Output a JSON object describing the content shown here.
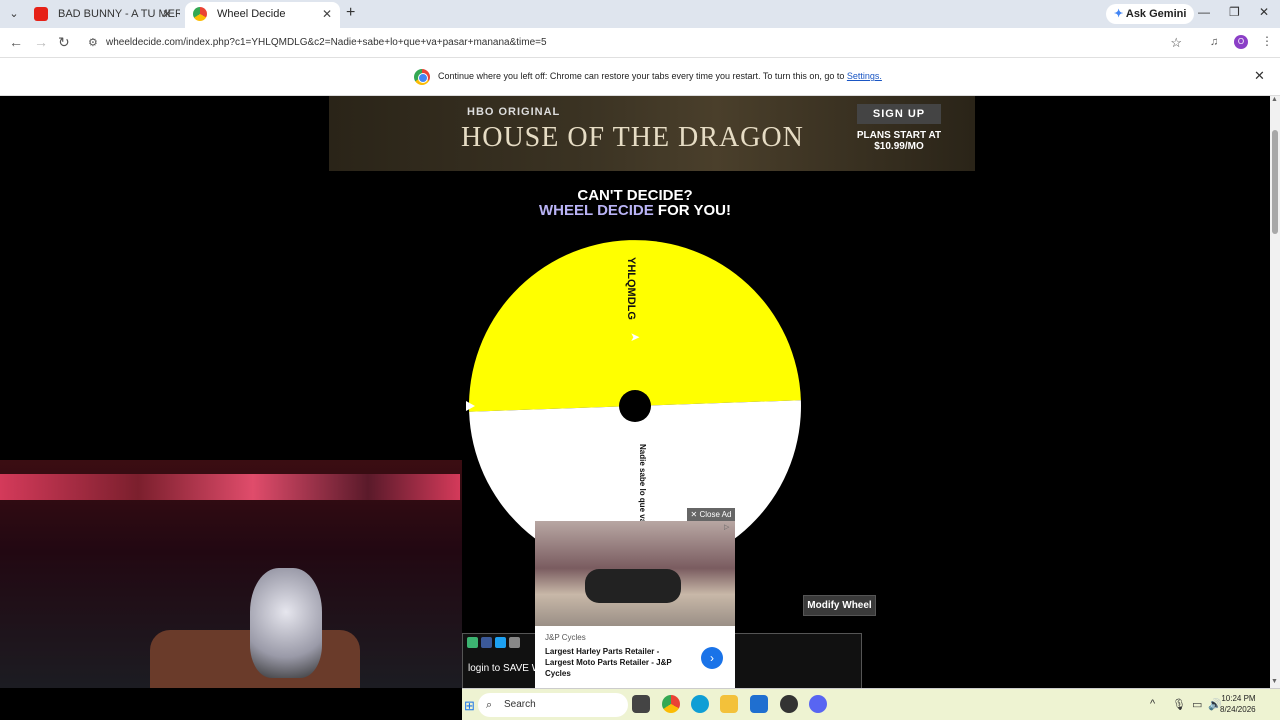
{
  "tabs": [
    {
      "title": "BAD BUNNY - A TU MERCED |",
      "close": "✕"
    },
    {
      "title": "Wheel Decide",
      "close": "✕"
    }
  ],
  "new_tab": "+",
  "gemini_label": "Ask Gemini",
  "window_controls": {
    "minimize": "—",
    "maximize": "❐",
    "close": "✕"
  },
  "nav": {
    "back": "←",
    "forward": "→",
    "reload": "↻"
  },
  "address": {
    "url": "wheeldecide.com/index.php?c1=YHLQMDLG&c2=Nadie+sabe+lo+que+va+pasar+manana&time=5",
    "star": "☆"
  },
  "profile_initial": "O",
  "infobar": {
    "message": "Continue where you left off: Chrome can restore your tabs every time you restart. To turn this on, go to",
    "link": "Settings.",
    "close": "✕"
  },
  "ad_banner": {
    "network": "HBO ORIGINAL",
    "title": "HOUSE OF THE DRAGON",
    "cta": "SIGN UP",
    "price_line1": "PLANS START AT",
    "price_line2": "$10.99/MO"
  },
  "headline": {
    "line1": "CAN'T DECIDE?",
    "accent": "WHEEL DECIDE",
    "rest": " FOR YOU!"
  },
  "wheel": {
    "segments": [
      {
        "label": "YHLQMDLG",
        "color": "#ffff00"
      },
      {
        "label": "Nadie sabe lo que va pasar ...",
        "color": "#ffffff"
      }
    ],
    "hub_color": "#000000"
  },
  "modify_button": "Modify Wheel",
  "save_text": "login to SAVE W",
  "close_ad": "✕ Close Ad",
  "ad_card": {
    "brand": "J&P Cycles",
    "title": "Largest Harley Parts Retailer - Largest Moto Parts Retailer - J&P Cycles",
    "go": "›",
    "adchoice": "▷"
  },
  "taskbar": {
    "start": "⊞",
    "search_placeholder": "Search",
    "time": "10:24 PM",
    "date": "8/24/2026"
  }
}
